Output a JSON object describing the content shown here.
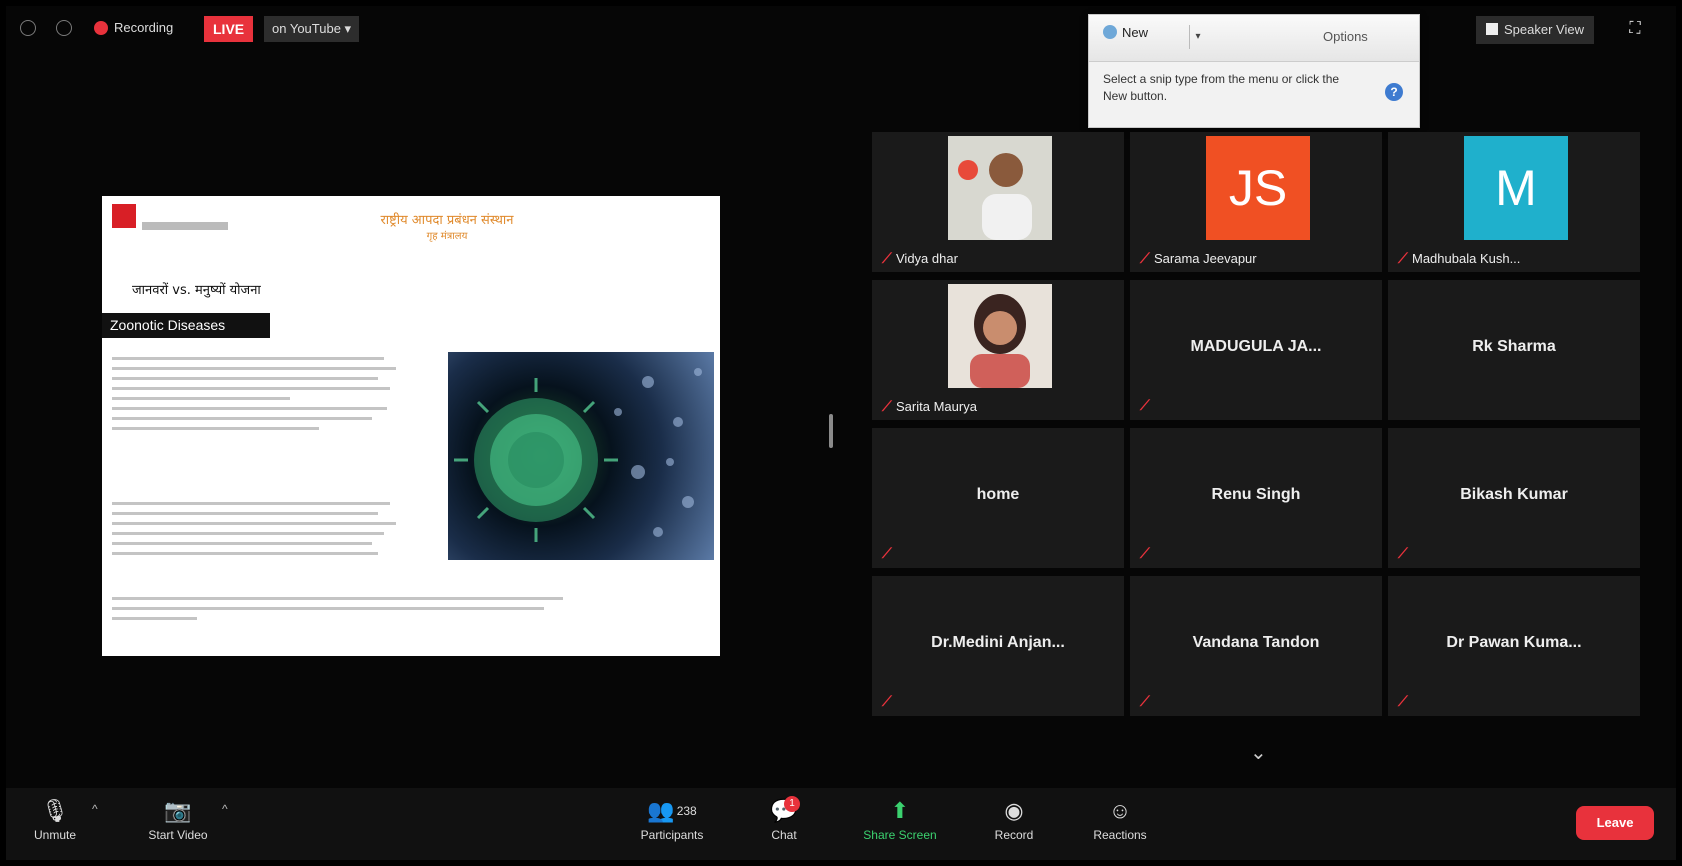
{
  "topbar": {
    "recording_label": "Recording",
    "live_label": "LIVE",
    "stream_label": "on YouTube ▾",
    "speaker_view_label": "Speaker View",
    "fullscreen_icon": "fullscreen-icon"
  },
  "snipping_tool": {
    "new_label": "New",
    "options_label": "Options",
    "message": "Select a snip type from the menu or click the New button."
  },
  "slide": {
    "title_hindi": "राष्ट्रीय आपदा प्रबंधन संस्थान",
    "subtitle_hindi": "गृह मंत्रालय",
    "heading_hindi": "जानवरों vs. मनुष्यों योजना",
    "banner": "Zoonotic Diseases",
    "accent": "#d81f26"
  },
  "gallery": {
    "tiles": [
      {
        "name": "Vidya dhar",
        "type": "photo"
      },
      {
        "name": "Sarama Jeevapur",
        "type": "avatar",
        "initials": "JS",
        "color": "#f05023"
      },
      {
        "name": "Madhubala Kush...",
        "type": "avatar",
        "initials": "M",
        "color": "#1fb0cc"
      },
      {
        "name": "Sarita Maurya",
        "type": "photo"
      },
      {
        "name": "MADUGULA JA...",
        "type": "name"
      },
      {
        "name": "Rk Sharma",
        "type": "name"
      },
      {
        "name": "home",
        "type": "name"
      },
      {
        "name": "Renu Singh",
        "type": "name"
      },
      {
        "name": "Bikash Kumar",
        "type": "name"
      },
      {
        "name": "Dr.Medini Anjan...",
        "type": "name"
      },
      {
        "name": "Vandana Tandon",
        "type": "name"
      },
      {
        "name": "Dr Pawan Kuma...",
        "type": "name"
      }
    ]
  },
  "toolbar": {
    "unmute_label": "Unmute",
    "start_video_label": "Start Video",
    "participants_label": "Participants",
    "participants_count": "238",
    "chat_label": "Chat",
    "chat_badge": "1",
    "share_label": "Share Screen",
    "record_label": "Record",
    "reactions_label": "Reactions",
    "leave_label": "Leave"
  },
  "colors": {
    "live_red": "#e8323c",
    "share_green": "#3bd16f"
  }
}
